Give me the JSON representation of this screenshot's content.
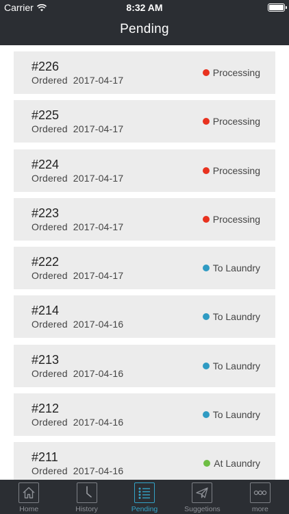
{
  "status_bar": {
    "carrier": "Carrier",
    "time": "8:32 AM"
  },
  "header": {
    "title": "Pending"
  },
  "colors": {
    "header_bg": "#2b2e33",
    "processing": "#e8321f",
    "to_laundry": "#2f9bc3",
    "at_laundry": "#6ebe44",
    "active_tab": "#34a4c8"
  },
  "orders": [
    {
      "id": "#226",
      "date_label": "Ordered",
      "date": "2017-04-17",
      "status": "Processing",
      "status_color": "#e8321f"
    },
    {
      "id": "#225",
      "date_label": "Ordered",
      "date": "2017-04-17",
      "status": "Processing",
      "status_color": "#e8321f"
    },
    {
      "id": "#224",
      "date_label": "Ordered",
      "date": "2017-04-17",
      "status": "Processing",
      "status_color": "#e8321f"
    },
    {
      "id": "#223",
      "date_label": "Ordered",
      "date": "2017-04-17",
      "status": "Processing",
      "status_color": "#e8321f"
    },
    {
      "id": "#222",
      "date_label": "Ordered",
      "date": "2017-04-17",
      "status": "To Laundry",
      "status_color": "#2f9bc3"
    },
    {
      "id": "#214",
      "date_label": "Ordered",
      "date": "2017-04-16",
      "status": "To Laundry",
      "status_color": "#2f9bc3"
    },
    {
      "id": "#213",
      "date_label": "Ordered",
      "date": "2017-04-16",
      "status": "To Laundry",
      "status_color": "#2f9bc3"
    },
    {
      "id": "#212",
      "date_label": "Ordered",
      "date": "2017-04-16",
      "status": "To Laundry",
      "status_color": "#2f9bc3"
    },
    {
      "id": "#211",
      "date_label": "Ordered",
      "date": "2017-04-16",
      "status": "At Laundry",
      "status_color": "#6ebe44"
    }
  ],
  "tabs": [
    {
      "label": "Home",
      "icon": "home-icon",
      "active": false
    },
    {
      "label": "History",
      "icon": "clock-icon",
      "active": false
    },
    {
      "label": "Pending",
      "icon": "list-icon",
      "active": true
    },
    {
      "label": "Suggetions",
      "icon": "paper-plane-icon",
      "active": false
    },
    {
      "label": "more",
      "icon": "more-icon",
      "active": false
    }
  ]
}
